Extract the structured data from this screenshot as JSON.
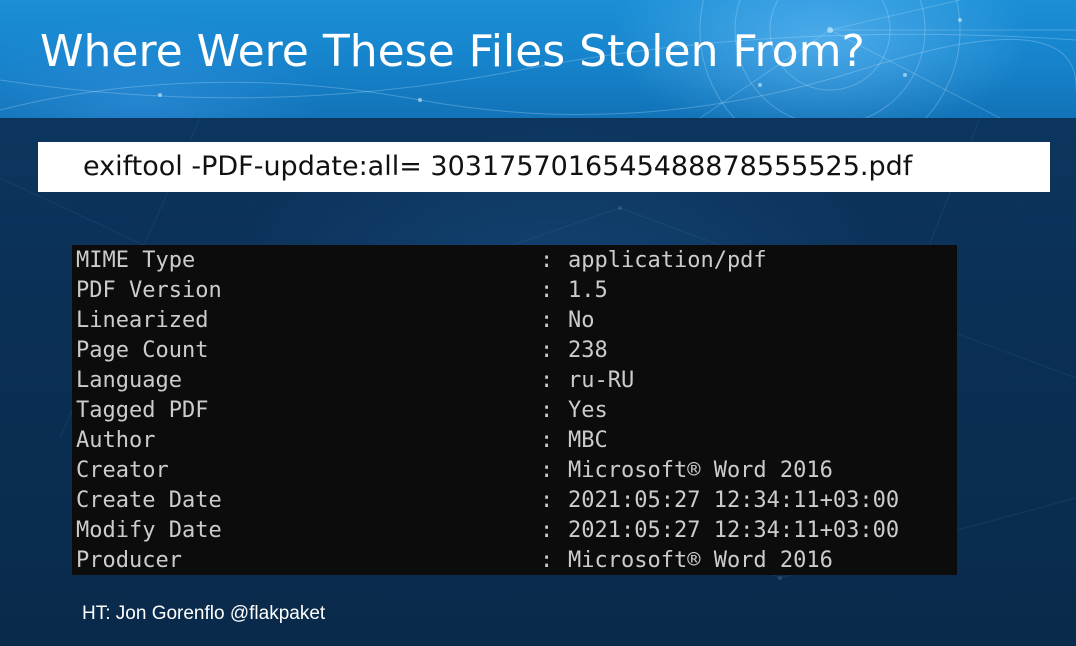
{
  "slide": {
    "title": "Where Were These Files Stolen From?",
    "command": "exiftool -PDF-update:all= 30317570165454888785555 25.pdf",
    "command_text": "exiftool -PDF-update:all= 3031757016545488878555525.pdf",
    "separator": ":",
    "metadata": [
      {
        "key": "MIME Type",
        "value": "application/pdf"
      },
      {
        "key": "PDF Version",
        "value": "1.5"
      },
      {
        "key": "Linearized",
        "value": "No"
      },
      {
        "key": "Page Count",
        "value": "238"
      },
      {
        "key": "Language",
        "value": "ru-RU"
      },
      {
        "key": "Tagged PDF",
        "value": "Yes"
      },
      {
        "key": "Author",
        "value": "MBC"
      },
      {
        "key": "Creator",
        "value": "Microsoft® Word 2016"
      },
      {
        "key": "Create Date",
        "value": "2021:05:27 12:34:11+03:00"
      },
      {
        "key": "Modify Date",
        "value": "2021:05:27 12:34:11+03:00"
      },
      {
        "key": "Producer",
        "value": "Microsoft® Word 2016"
      }
    ],
    "credit": "HT: Jon Gorenflo @flakpaket"
  },
  "colors": {
    "header_blue": "#1684cc",
    "background_navy": "#0b2d4e",
    "terminal_bg": "#0c0c0c",
    "terminal_text": "#cccccc",
    "command_box": "#ffffff"
  }
}
